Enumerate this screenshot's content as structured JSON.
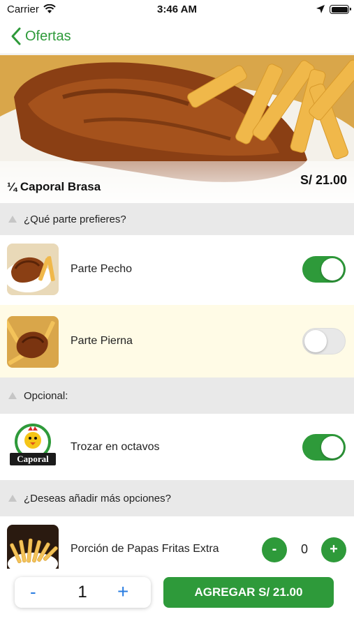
{
  "status_bar": {
    "carrier": "Carrier",
    "time": "3:46 AM"
  },
  "nav": {
    "back_label": "Ofertas"
  },
  "product": {
    "name": "¼ Caporal Brasa",
    "price": "S/ 21.00"
  },
  "sections": [
    {
      "title": "¿Qué parte prefieres?"
    },
    {
      "title": "Opcional:"
    },
    {
      "title": "¿Deseas añadir más opciones?"
    }
  ],
  "options": [
    {
      "label": "Parte Pecho",
      "selected": true,
      "icon": "chicken-breast-image"
    },
    {
      "label": "Parte Pierna",
      "selected": false,
      "icon": "chicken-leg-image"
    }
  ],
  "optional": [
    {
      "label": "Trozar en octavos",
      "selected": true,
      "icon": "caporal-logo",
      "logo_text": "Caporal"
    }
  ],
  "extras": [
    {
      "label": "Porción de Papas Fritas Extra",
      "quantity": "0",
      "minus": "-",
      "plus": "+",
      "icon": "french-fries-image"
    }
  ],
  "footer": {
    "minus": "-",
    "quantity": "1",
    "plus": "+",
    "add_label": "AGREGAR S/ 21.00"
  },
  "colors": {
    "accent": "#2e9a3a",
    "link": "#2a7de1",
    "section_bg": "#e9e9e9",
    "highlight_row": "#fffbe6"
  }
}
